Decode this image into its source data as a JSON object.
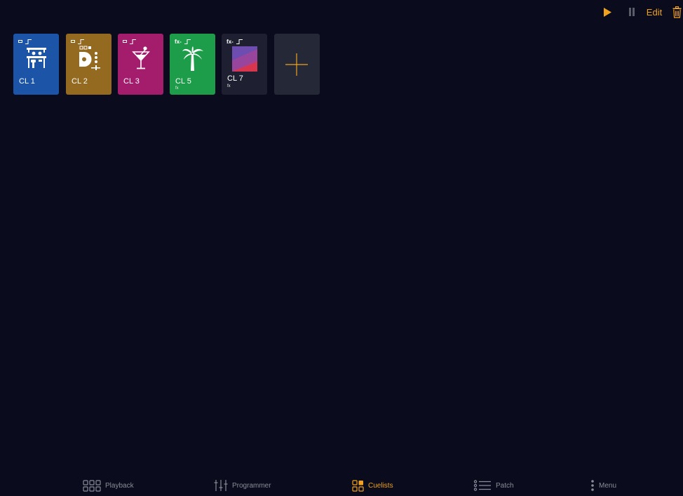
{
  "colors": {
    "background": "#0a0b1c",
    "accent": "#f0a21c",
    "nav_inactive": "#8a8c99"
  },
  "toolbar": {
    "play_icon": "play-icon",
    "pause_icon": "pause-icon",
    "edit_label": "Edit",
    "delete_icon": "trash-icon"
  },
  "cuelists": [
    {
      "label": "CL 1",
      "color": "#1c55a8",
      "icon": "bar-counter-icon",
      "fx": false,
      "sub": ""
    },
    {
      "label": "CL 2",
      "color": "#946920",
      "icon": "dj-mixer-icon",
      "fx": false,
      "sub": ""
    },
    {
      "label": "CL 3",
      "color": "#a41d6d",
      "icon": "cocktail-icon",
      "fx": false,
      "sub": ""
    },
    {
      "label": "CL 5",
      "color": "#1d9c4a",
      "icon": "palm-tree-icon",
      "fx": true,
      "sub": "fx"
    },
    {
      "label": "CL 7",
      "color": "#1e2031",
      "icon": "color-gradient-icon",
      "fx": true,
      "sub": "fx"
    }
  ],
  "add_tile": {
    "color": "#252836",
    "icon": "plus-icon"
  },
  "indicators": {
    "fx_text": "fx-"
  },
  "nav": [
    {
      "label": "Playback",
      "icon": "grid-icon",
      "active": false
    },
    {
      "label": "Programmer",
      "icon": "sliders-icon",
      "active": false
    },
    {
      "label": "Cuelists",
      "icon": "cuelists-icon",
      "active": true
    },
    {
      "label": "Patch",
      "icon": "list-icon",
      "active": false
    },
    {
      "label": "Menu",
      "icon": "more-icon",
      "active": false
    }
  ]
}
